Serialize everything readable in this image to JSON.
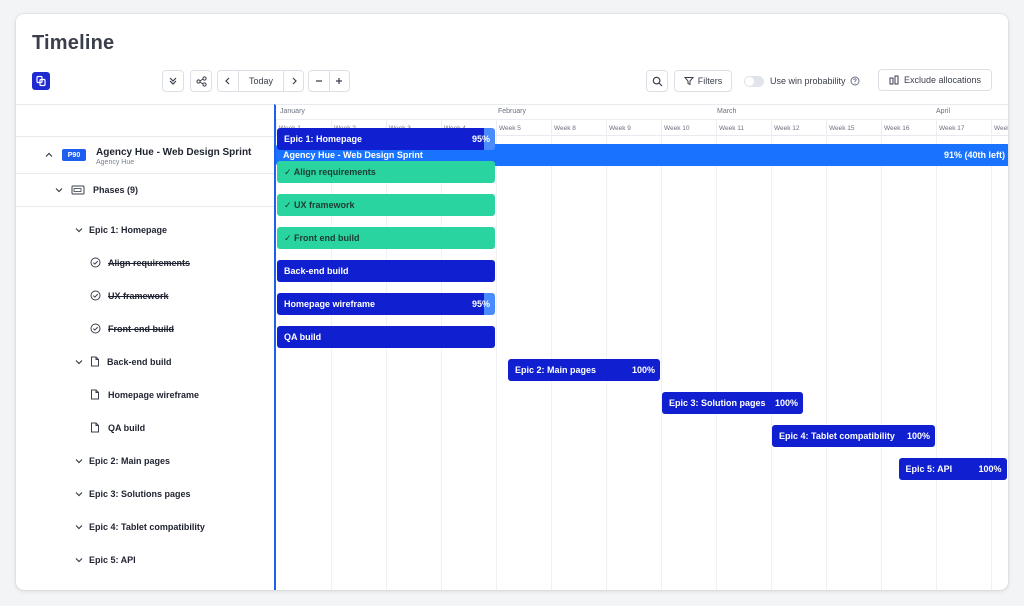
{
  "page": {
    "title": "Timeline"
  },
  "toolbar": {
    "today_label": "Today",
    "filters_label": "Filters",
    "win_probability_label": "Use win probability",
    "exclude_allocations_label": "Exclude allocations"
  },
  "project": {
    "badge": "P90",
    "name": "Agency Hue - Web Design Sprint",
    "client": "Agency Hue",
    "bar_label": "Agency Hue - Web Design Sprint",
    "bar_status": "91% (40th left)"
  },
  "phases_label": "Phases (9)",
  "months": [
    "January",
    "February",
    "March",
    "April"
  ],
  "weeks": [
    "Week 1",
    "Week 2",
    "Week 3",
    "Week 4",
    "Week 5",
    "Week 8",
    "Week 9",
    "Week 10",
    "Week 11",
    "Week 12",
    "Week 15",
    "Week 16",
    "Week 17",
    "Week"
  ],
  "rows": [
    {
      "label": "Epic 1: Homepage",
      "type": "epic",
      "bar": {
        "label": "Epic 1: Homepage",
        "pct": "95%",
        "start": 0,
        "length": 4,
        "progress": 0.95
      }
    },
    {
      "label": "Align requirements",
      "type": "done",
      "bar": {
        "label": "Align requirements",
        "start": 0,
        "length": 4
      }
    },
    {
      "label": "UX framework",
      "type": "done",
      "bar": {
        "label": "UX framework",
        "start": 0,
        "length": 4
      }
    },
    {
      "label": "Front-end build",
      "type": "done",
      "bar": {
        "label": "Front end build",
        "start": 0,
        "length": 4
      }
    },
    {
      "label": "Back-end build",
      "type": "doc-epic",
      "bar": {
        "label": "Back-end build",
        "start": 0,
        "length": 4
      }
    },
    {
      "label": "Homepage wireframe",
      "type": "doc",
      "bar": {
        "label": "Homepage wireframe",
        "pct": "95%",
        "start": 0,
        "length": 4,
        "progress": 0.95
      }
    },
    {
      "label": "QA build",
      "type": "doc",
      "bar": {
        "label": "QA build",
        "start": 0,
        "length": 4
      }
    },
    {
      "label": "Epic 2: Main pages",
      "type": "epic",
      "bar": {
        "label": "Epic 2: Main pages",
        "pct": "100%",
        "start": 4.2,
        "length": 2.8
      }
    },
    {
      "label": "Epic 3: Solutions pages",
      "type": "epic",
      "bar": {
        "label": "Epic 3: Solution pages",
        "pct": "100%",
        "start": 7,
        "length": 2.6
      }
    },
    {
      "label": "Epic 4: Tablet compatibility",
      "type": "epic",
      "bar": {
        "label": "Epic 4: Tablet compatibility",
        "pct": "100%",
        "start": 9,
        "length": 3
      }
    },
    {
      "label": "Epic 5: API",
      "type": "epic",
      "bar": {
        "label": "Epic 5: API",
        "pct": "100%",
        "start": 11.3,
        "length": 2
      }
    }
  ],
  "colors": {
    "primary": "#1020d0",
    "project_bar": "#1a73ff",
    "done_bar": "#2ad4a0",
    "progress_remaining": "#4a8cff"
  }
}
